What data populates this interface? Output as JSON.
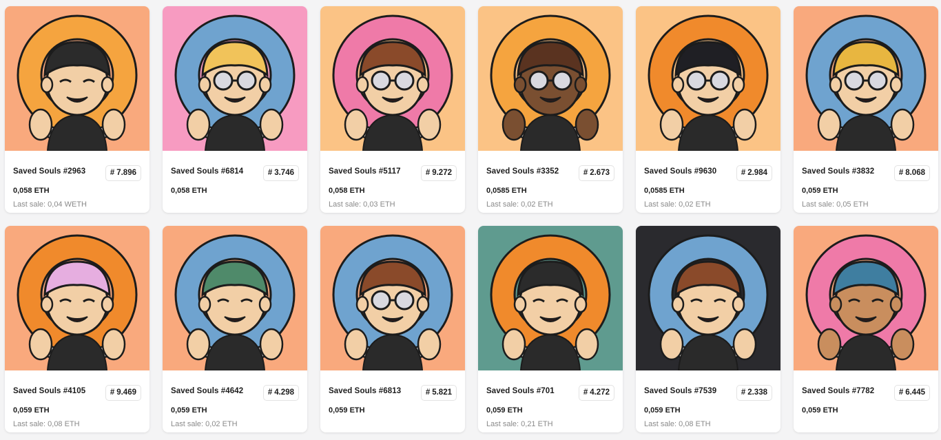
{
  "collection": "Saved Souls",
  "items": [
    {
      "name": "Saved Souls #2963",
      "rank": "7.896",
      "price": "0,058 ETH",
      "last_sale": "Last sale: 0,04 WETH",
      "bg": "#f9a97d",
      "ring": "#f5a43f",
      "hat": "pirate-hat",
      "glasses": false,
      "skin": "#f2cfa6"
    },
    {
      "name": "Saved Souls #6814",
      "rank": "3.746",
      "price": "0,058 ETH",
      "last_sale": "",
      "bg": "#f79bc1",
      "ring": "#6fa3cf",
      "hat": "blonde-hair",
      "glasses": true,
      "skin": "#f2cfa6"
    },
    {
      "name": "Saved Souls #5117",
      "rank": "9.272",
      "price": "0,058 ETH",
      "last_sale": "Last sale: 0,03 ETH",
      "bg": "#fbc385",
      "ring": "#ef7aa8",
      "hat": "brown-hair",
      "glasses": true,
      "skin": "#f2cfa6"
    },
    {
      "name": "Saved Souls #3352",
      "rank": "2.673",
      "price": "0,0585 ETH",
      "last_sale": "Last sale: 0,02 ETH",
      "bg": "#fbc385",
      "ring": "#f5a43f",
      "hat": "brown-cap",
      "glasses": true,
      "skin": "#7a4f31"
    },
    {
      "name": "Saved Souls #9630",
      "rank": "2.984",
      "price": "0,0585 ETH",
      "last_sale": "Last sale: 0,02 ETH",
      "bg": "#fbc385",
      "ring": "#f08a2c",
      "hat": "black-hair",
      "glasses": true,
      "skin": "#f2cfa6"
    },
    {
      "name": "Saved Souls #3832",
      "rank": "8.068",
      "price": "0,059 ETH",
      "last_sale": "Last sale: 0,05 ETH",
      "bg": "#f9a97d",
      "ring": "#6fa3cf",
      "hat": "gold-crown",
      "glasses": true,
      "skin": "#f2cfa6"
    },
    {
      "name": "Saved Souls #4105",
      "rank": "9.469",
      "price": "0,059 ETH",
      "last_sale": "Last sale: 0,08 ETH",
      "bg": "#f9a97d",
      "ring": "#f08a2c",
      "hat": "pink-bucket-hat",
      "glasses": false,
      "skin": "#f2cfa6"
    },
    {
      "name": "Saved Souls #4642",
      "rank": "4.298",
      "price": "0,059 ETH",
      "last_sale": "Last sale: 0,02 ETH",
      "bg": "#f9a97d",
      "ring": "#6fa3cf",
      "hat": "army-helmet",
      "glasses": false,
      "skin": "#f2cfa6"
    },
    {
      "name": "Saved Souls #6813",
      "rank": "5.821",
      "price": "0,059 ETH",
      "last_sale": "",
      "bg": "#f9a97d",
      "ring": "#6fa3cf",
      "hat": "headband",
      "glasses": true,
      "skin": "#f2cfa6"
    },
    {
      "name": "Saved Souls #701",
      "rank": "4.272",
      "price": "0,059 ETH",
      "last_sale": "Last sale: 0,21 ETH",
      "bg": "#5f9b8f",
      "ring": "#f08a2c",
      "hat": "bowler-hat",
      "glasses": false,
      "skin": "#f2cfa6"
    },
    {
      "name": "Saved Souls #7539",
      "rank": "2.338",
      "price": "0,059 ETH",
      "last_sale": "Last sale: 0,08 ETH",
      "bg": "#2a2a2e",
      "ring": "#6fa3cf",
      "hat": "brown-hair",
      "glasses": false,
      "skin": "#f2cfa6"
    },
    {
      "name": "Saved Souls #7782",
      "rank": "6.445",
      "price": "0,059 ETH",
      "last_sale": "",
      "bg": "#f9a97d",
      "ring": "#ef7aa8",
      "hat": "blue-beanie",
      "glasses": false,
      "skin": "#c98e5e"
    }
  ],
  "hat_colors": {
    "pirate-hat": "#2b2b2b",
    "blonde-hair": "#f1c35a",
    "brown-hair": "#8a4a2a",
    "brown-cap": "#5a3320",
    "black-hair": "#1f1f24",
    "gold-crown": "#e8b640",
    "pink-bucket-hat": "#e6aee0",
    "army-helmet": "#4f8a6a",
    "headband": "#8a4a2a",
    "bowler-hat": "#2b2b2b",
    "blue-beanie": "#3f7ea0"
  }
}
